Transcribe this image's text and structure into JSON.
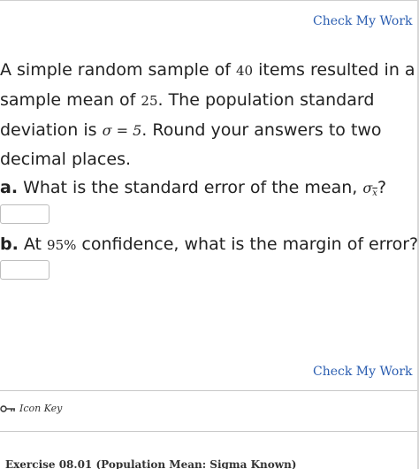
{
  "header": {
    "check_label": "Check My Work"
  },
  "problem": {
    "line1_pre": "A simple random sample of ",
    "sample_size": "40",
    "line1_post": " items resulted in a",
    "line2_pre": "sample mean of ",
    "sample_mean": "25",
    "line2_post": ". The population standard",
    "line3_pre": "deviation is ",
    "sigma_expr": "σ = 5",
    "line3_post": ". Round your answers to two",
    "line4": "decimal places."
  },
  "questions": {
    "a": {
      "letter": "a.",
      "text": " What is the standard error of the mean, ",
      "symbol_main": "σ",
      "symbol_sub": "x",
      "end": "?",
      "answer_value": ""
    },
    "b": {
      "letter": "b.",
      "text_pre": " At ",
      "confidence": "95%",
      "text_post": " confidence, what is the margin of error?",
      "answer_value": ""
    }
  },
  "footer": {
    "check_label": "Check My Work",
    "icon_key_label": "Icon Key",
    "exercise_title": "Exercise 08.01 (Population Mean: Sigma Known)"
  },
  "colors": {
    "link": "#2a5db0",
    "text": "#222222",
    "border": "#bdbdbd"
  },
  "icons": [
    "key-icon"
  ]
}
